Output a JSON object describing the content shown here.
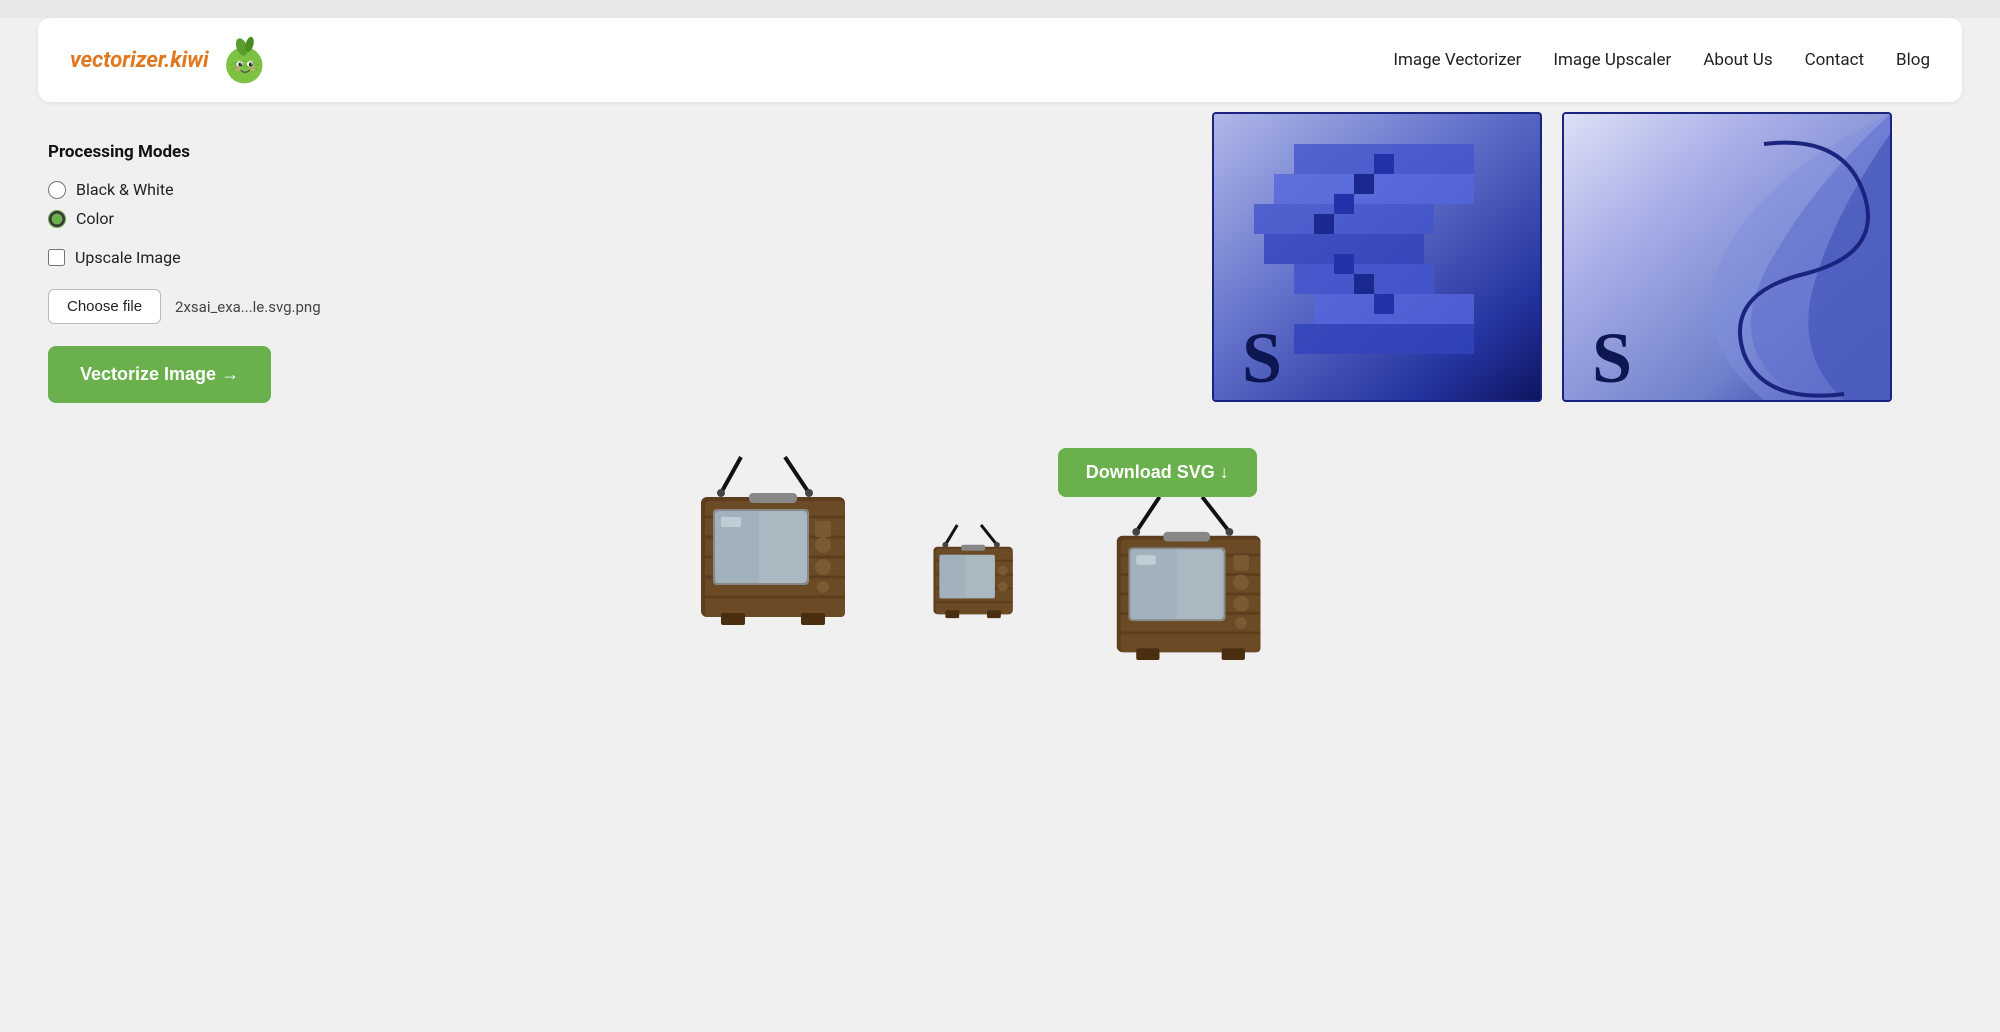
{
  "header": {
    "logo_text": "vectorizer.kiwi",
    "nav_items": [
      {
        "label": "Image Vectorizer",
        "id": "nav-image-vectorizer"
      },
      {
        "label": "Image Upscaler",
        "id": "nav-image-upscaler"
      },
      {
        "label": "About Us",
        "id": "nav-about-us"
      },
      {
        "label": "Contact",
        "id": "nav-contact"
      },
      {
        "label": "Blog",
        "id": "nav-blog"
      }
    ]
  },
  "sidebar": {
    "processing_modes_title": "Processing Modes",
    "mode_bw_label": "Black & White",
    "mode_color_label": "Color",
    "upscale_label": "Upscale Image",
    "choose_file_label": "Choose file",
    "file_name": "2xsai_exa...le.svg.png",
    "vectorize_btn_label": "Vectorize Image →"
  },
  "main": {
    "download_svg_label": "Download SVG ↓"
  },
  "colors": {
    "green_accent": "#6ab04c",
    "dark_blue": "#1a237e",
    "orange": "#e07820"
  }
}
